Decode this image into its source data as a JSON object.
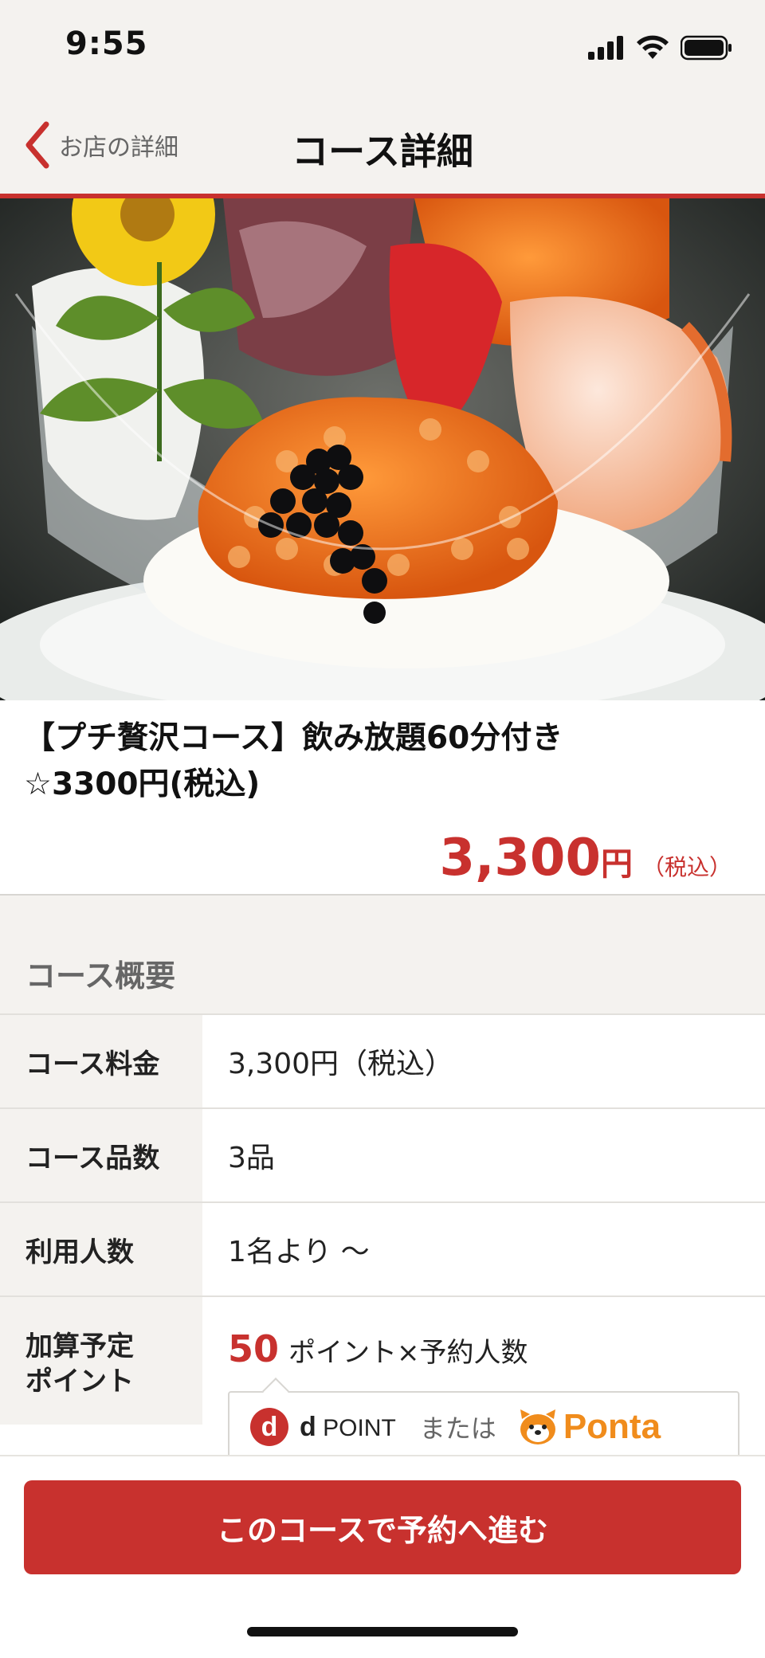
{
  "status_bar": {
    "time": "9:55"
  },
  "nav": {
    "back_label": "お店の詳細",
    "title": "コース詳細"
  },
  "course": {
    "name_line1": "【プチ贅沢コース】飲み放題60分付き",
    "name_line2": "☆3300円(税込)",
    "price_value": "3,300",
    "price_unit": "円",
    "price_tax": "（税込）"
  },
  "summary": {
    "section_title": "コース概要",
    "rows": [
      {
        "label": "コース料金",
        "value": "3,300円（税込）"
      },
      {
        "label": "コース品数",
        "value": "3品"
      },
      {
        "label": "利用人数",
        "value": "1名より ～"
      }
    ],
    "points": {
      "label_line1": "加算予定",
      "label_line2": "ポイント",
      "value": "50",
      "suffix": "ポイント×予約人数",
      "dpoint_letter": "d",
      "dpoint_brand_bold": "d",
      "dpoint_brand_rest": "POINT",
      "or": "または",
      "ponta": "Ponta"
    }
  },
  "cta": {
    "label": "このコースで予約へ進む"
  },
  "colors": {
    "accent": "#c8312e",
    "background": "#f4f2ef",
    "ponta_orange": "#f08c1c"
  },
  "icons": [
    "signal-icon",
    "wifi-icon",
    "battery-icon",
    "chevron-left-icon",
    "ponta-icon"
  ]
}
